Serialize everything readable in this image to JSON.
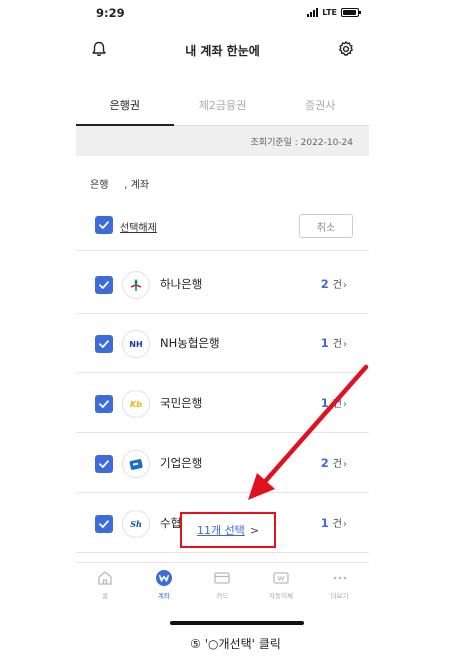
{
  "status_bar": {
    "time": "9:29",
    "network": "LTE",
    "battery_level": 0.9
  },
  "header": {
    "title": "내 계좌 한눈에",
    "left_icon": "bell-icon",
    "right_icon": "gear-icon"
  },
  "tabs": [
    {
      "label": "은행권",
      "active": true
    },
    {
      "label": "제2금융권",
      "active": false
    },
    {
      "label": "증권사",
      "active": false
    }
  ],
  "date_bar": {
    "text": "조회기준일 : 2022-10-24"
  },
  "summary": {
    "text": "은행     , 계좌"
  },
  "select_all": {
    "label": "선택해제",
    "cancel_label": "취소"
  },
  "banks": [
    {
      "name": "하나은행",
      "count": "2",
      "unit": "건",
      "logo_icon": "hana-bank-logo",
      "logo_color": "#009490"
    },
    {
      "name": "NH농협은행",
      "count": "1",
      "unit": "건",
      "logo_icon": "nh-bank-logo",
      "logo_text": "NH",
      "logo_color": "#1f3b8e"
    },
    {
      "name": "국민은행",
      "count": "1",
      "unit": "건",
      "logo_icon": "kb-bank-logo",
      "logo_text": "Kb",
      "logo_color": "#f2b600"
    },
    {
      "name": "기업은행",
      "count": "2",
      "unit": "건",
      "logo_icon": "ibk-bank-logo",
      "logo_color": "#1a6fc4"
    },
    {
      "name": "수협",
      "count": "1",
      "unit": "건",
      "logo_icon": "sh-bank-logo",
      "logo_text": "Sh",
      "logo_color": "#0a4ea2"
    }
  ],
  "floating_select": {
    "label": "11개 선택",
    "chevron": ">"
  },
  "tabbar": [
    {
      "label": "홈",
      "icon": "home-icon",
      "active": false
    },
    {
      "label": "계좌",
      "icon": "account-icon",
      "active": true
    },
    {
      "label": "카드",
      "icon": "card-icon",
      "active": false
    },
    {
      "label": "자동이체",
      "icon": "auto-transfer-icon",
      "active": false
    },
    {
      "label": "더보기",
      "icon": "more-icon",
      "active": false
    }
  ],
  "caption": {
    "text": "⑤ '○개선택' 클릭"
  },
  "colors": {
    "accent": "#3d6bd9",
    "highlight": "#e0121f"
  }
}
